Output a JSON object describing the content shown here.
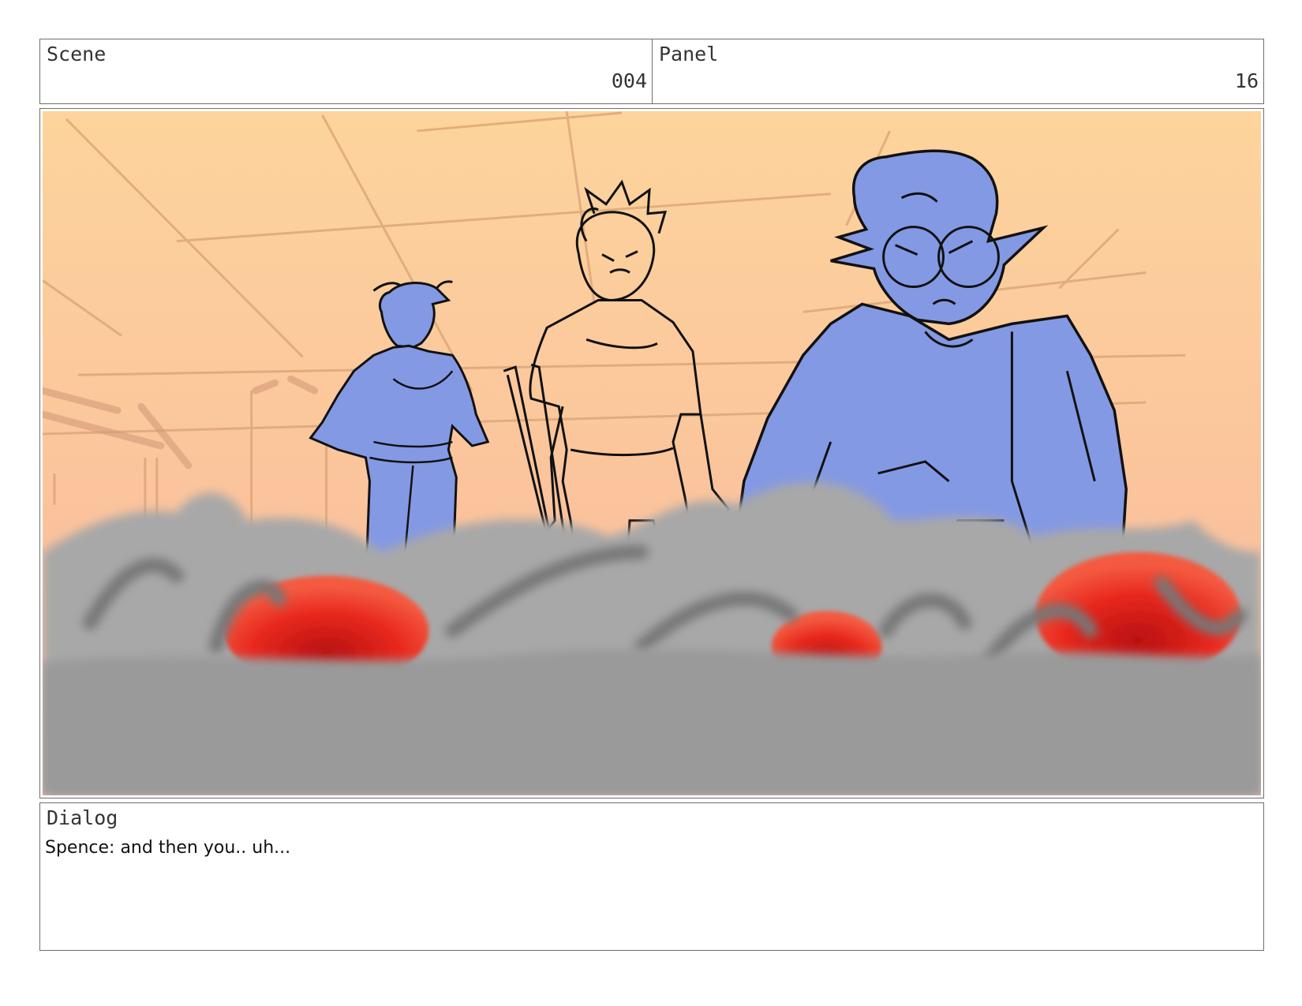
{
  "header": {
    "scene_label": "Scene",
    "scene_value": "004",
    "panel_label": "Panel",
    "panel_value": "16"
  },
  "image": {
    "colors": {
      "sky_top": "#FDD49C",
      "sky_bottom": "#F9B79D",
      "character_blue": "#8499E3",
      "foreground_grey": "#999999",
      "accent_red": "#E8281E",
      "lineart": "#111111"
    }
  },
  "dialog": {
    "label": "Dialog",
    "text": "Spence: and then you.. uh..."
  }
}
